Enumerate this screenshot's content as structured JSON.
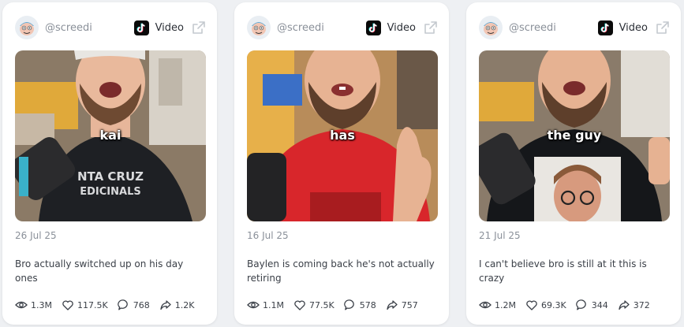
{
  "colors": {
    "accent_tiktok": "#0a0a0a",
    "muted_text": "#8a9099",
    "body_text": "#3b4048"
  },
  "cards": [
    {
      "handle": "@screedi",
      "platform": "Video",
      "platform_icon": "tiktok-icon",
      "overlay_caption": "kai",
      "shirt_color": "#1e2024",
      "date": "26 Jul 25",
      "description": "Bro actually switched up on his day ones",
      "stats": {
        "views": "1.3M",
        "likes": "117.5K",
        "comments": "768",
        "shares": "1.2K"
      }
    },
    {
      "handle": "@screedi",
      "platform": "Video",
      "platform_icon": "tiktok-icon",
      "overlay_caption": "has",
      "shirt_color": "#d8262b",
      "date": "16 Jul 25",
      "description": "Baylen is coming back he's not actually retiring",
      "stats": {
        "views": "1.1M",
        "likes": "77.5K",
        "comments": "578",
        "shares": "757"
      }
    },
    {
      "handle": "@screedi",
      "platform": "Video",
      "platform_icon": "tiktok-icon",
      "overlay_caption": "the guy",
      "shirt_color": "#15171a",
      "date": "21 Jul 25",
      "description": "I can't believe bro is still at it this is crazy",
      "stats": {
        "views": "1.2M",
        "likes": "69.3K",
        "comments": "344",
        "shares": "372"
      }
    }
  ]
}
